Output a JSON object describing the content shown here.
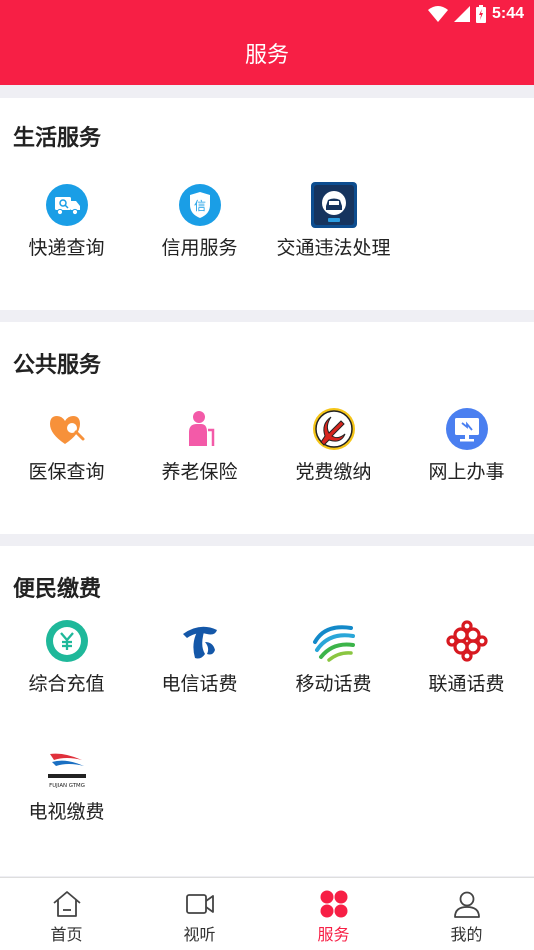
{
  "status": {
    "time": "5:44"
  },
  "header": {
    "title": "服务"
  },
  "sections": [
    {
      "title": "生活服务",
      "items": [
        {
          "label": "快递查询",
          "icon": "delivery-truck-icon"
        },
        {
          "label": "信用服务",
          "icon": "credit-shield-icon"
        },
        {
          "label": "交通违法处理",
          "icon": "traffic-car-icon"
        }
      ]
    },
    {
      "title": "公共服务",
      "items": [
        {
          "label": "医保查询",
          "icon": "heart-search-icon"
        },
        {
          "label": "养老保险",
          "icon": "elderly-person-icon"
        },
        {
          "label": "党费缴纳",
          "icon": "party-emblem-icon"
        },
        {
          "label": "网上办事",
          "icon": "monitor-icon"
        }
      ]
    },
    {
      "title": "便民缴费",
      "items": [
        {
          "label": "综合充值",
          "icon": "yuan-coin-icon"
        },
        {
          "label": "电信话费",
          "icon": "china-telecom-icon"
        },
        {
          "label": "移动话费",
          "icon": "china-mobile-icon"
        },
        {
          "label": "联通话费",
          "icon": "china-unicom-icon"
        },
        {
          "label": "电视缴费",
          "icon": "fujian-tv-icon",
          "logo_text": "FUJIAN GTMG"
        }
      ]
    }
  ],
  "tabbar": [
    {
      "label": "首页",
      "icon": "home-icon",
      "active": false
    },
    {
      "label": "视听",
      "icon": "video-camera-icon",
      "active": false
    },
    {
      "label": "服务",
      "icon": "services-grid-icon",
      "active": true
    },
    {
      "label": "我的",
      "icon": "user-icon",
      "active": false
    }
  ],
  "colors": {
    "accent": "#f71f45",
    "background": "#efeff4",
    "card": "#ffffff",
    "text": "#222222"
  }
}
